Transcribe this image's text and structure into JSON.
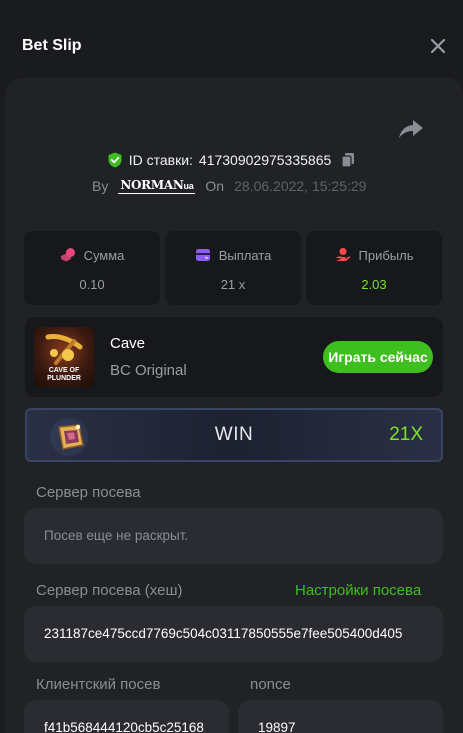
{
  "header": {
    "title": "Bet Slip"
  },
  "bet": {
    "id_label": "ID ставки:",
    "id_value": "41730902975335865",
    "by_label": "By",
    "username": "NORMAN",
    "username_suffix": "ua",
    "on_label": "On",
    "datetime": "28.06.2022, 15:25:29"
  },
  "stats": [
    {
      "label": "Сумма",
      "value": "0.10",
      "icon": "coins-icon",
      "color": "#e8467c"
    },
    {
      "label": "Выплата",
      "value": "21 x",
      "icon": "wallet-icon",
      "color": "#8c5cf5"
    },
    {
      "label": "Прибыль",
      "value": "2.03",
      "icon": "profit-icon",
      "color": "#ff4a4a",
      "value_color": "#7be32c"
    }
  ],
  "game": {
    "thumb_text": "CAVE OF PLUNDER",
    "name": "Cave",
    "provider": "BC Original",
    "play_label": "Играть сейчас"
  },
  "result": {
    "word": "WIN",
    "multiplier": "21X"
  },
  "seed": {
    "server_label": "Сервер посева",
    "server_placeholder": "Посев еще не раскрыт.",
    "hash_label": "Сервер посева (хеш)",
    "settings_link": "Настройки посева",
    "hash_value": "231187ce475ccd7769c504c03117850555e7fee505400d405",
    "client_label": "Клиентский посев",
    "client_value": "f41b568444120cb5c25168",
    "nonce_label": "nonce",
    "nonce_value": "19897"
  },
  "colors": {
    "accent_green": "#3fbf1f",
    "background": "#1a1b1f",
    "panel": "#202226"
  }
}
